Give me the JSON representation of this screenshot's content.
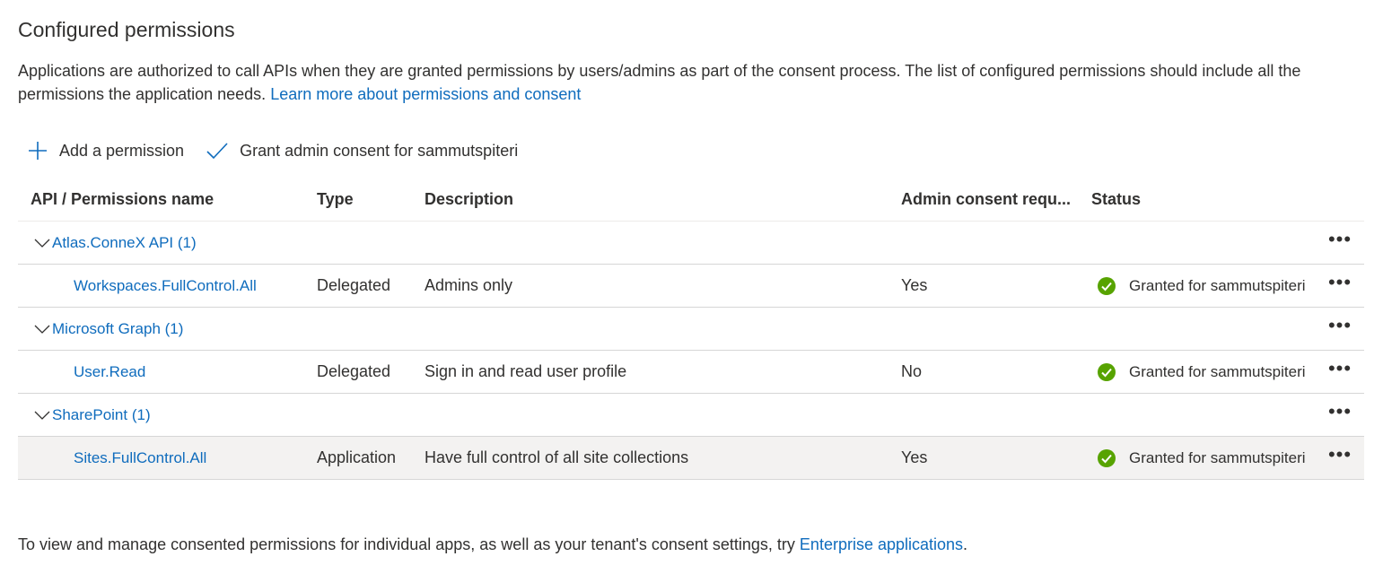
{
  "section": {
    "title": "Configured permissions",
    "description": "Applications are authorized to call APIs when they are granted permissions by users/admins as part of the consent process. The list of configured permissions should include all the permissions the application needs.",
    "learn_more": "Learn more about permissions and consent"
  },
  "toolbar": {
    "add_label": "Add a permission",
    "grant_label": "Grant admin consent for sammutspiteri"
  },
  "table": {
    "headers": {
      "name": "API / Permissions name",
      "type": "Type",
      "description": "Description",
      "admin_consent": "Admin consent requ...",
      "status": "Status"
    },
    "groups": [
      {
        "label": "Atlas.ConneX API (1)",
        "permission": {
          "name": "Workspaces.FullControl.All",
          "type": "Delegated",
          "description": "Admins only",
          "admin_consent": "Yes",
          "status": "Granted for sammutspiteri"
        }
      },
      {
        "label": "Microsoft Graph (1)",
        "permission": {
          "name": "User.Read",
          "type": "Delegated",
          "description": "Sign in and read user profile",
          "admin_consent": "No",
          "status": "Granted for sammutspiteri"
        }
      },
      {
        "label": "SharePoint (1)",
        "permission": {
          "name": "Sites.FullControl.All",
          "type": "Application",
          "description": "Have full control of all site collections",
          "admin_consent": "Yes",
          "status": "Granted for sammutspiteri"
        }
      }
    ],
    "more_glyph": "•••"
  },
  "footer": {
    "text": "To view and manage consented permissions for individual apps, as well as your tenant's consent settings, try",
    "link": "Enterprise applications",
    "end": "."
  },
  "colors": {
    "link": "#0f6cbd",
    "success": "#57a300",
    "selected_row": "#f3f2f1"
  }
}
